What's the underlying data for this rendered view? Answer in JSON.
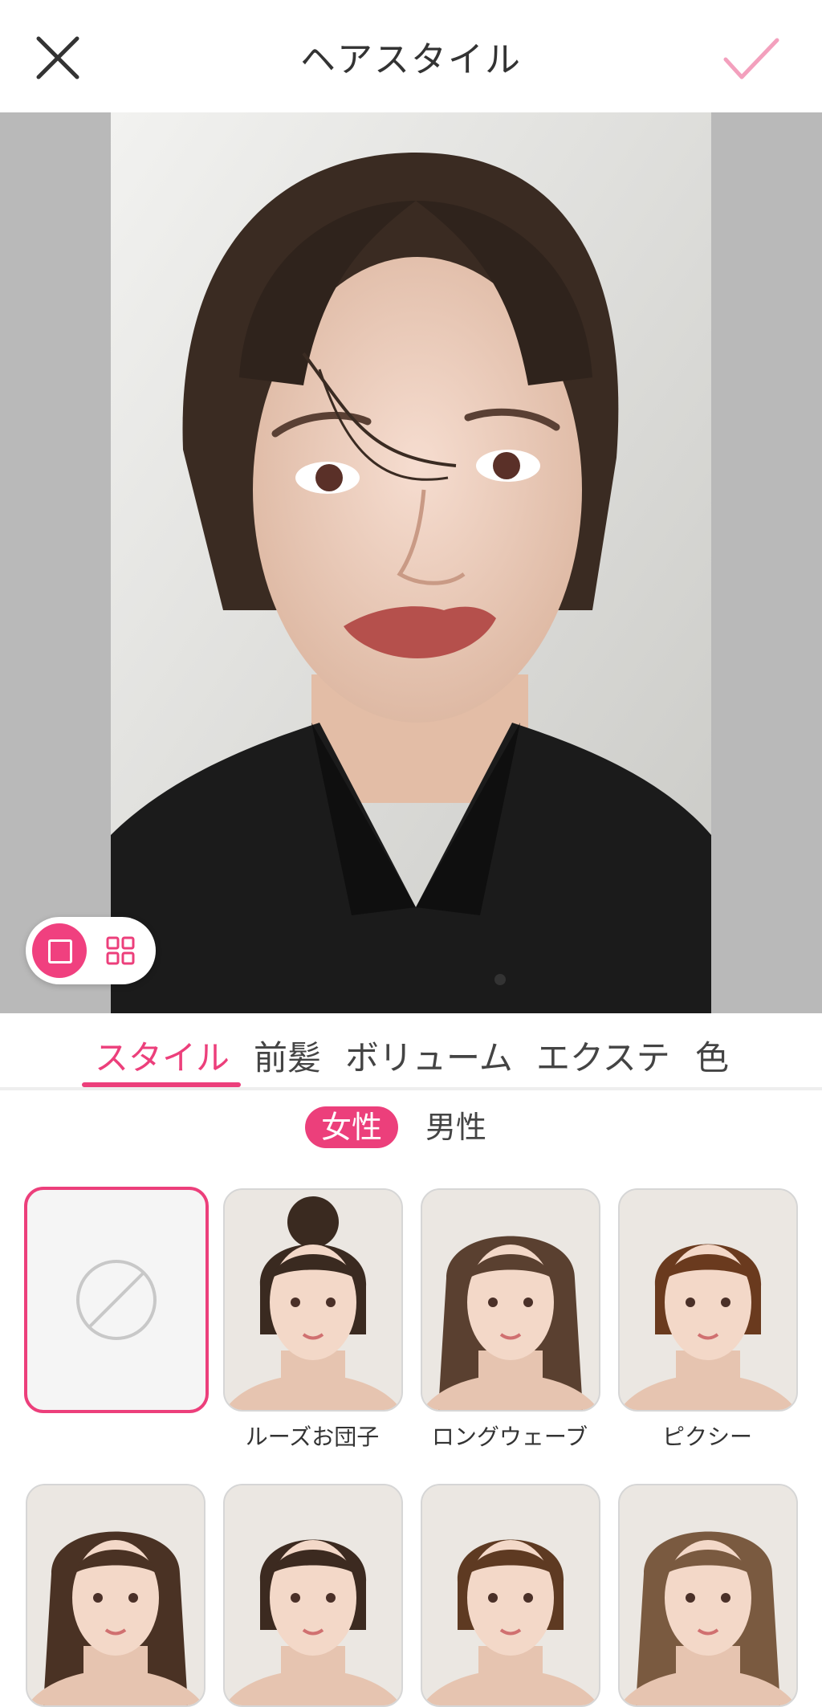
{
  "header": {
    "title": "ヘアスタイル"
  },
  "tabs": [
    {
      "label": "スタイル",
      "active": true
    },
    {
      "label": "前髪",
      "active": false
    },
    {
      "label": "ボリューム",
      "active": false
    },
    {
      "label": "エクステ",
      "active": false
    },
    {
      "label": "色",
      "active": false
    }
  ],
  "gender": {
    "female": "女性",
    "male": "男性",
    "selected": "女性"
  },
  "styles": [
    {
      "label": "",
      "type": "none",
      "selected": true
    },
    {
      "label": "ルーズお団子",
      "hair": "#3a2a20"
    },
    {
      "label": "ロングウェーブ",
      "hair": "#5a4030"
    },
    {
      "label": "ピクシー",
      "hair": "#6a3a1e"
    },
    {
      "label": "",
      "hair": "#4a3224"
    },
    {
      "label": "",
      "hair": "#3c2a20"
    },
    {
      "label": "",
      "hair": "#5e3a22"
    },
    {
      "label": "",
      "hair": "#7a5a40"
    }
  ],
  "colors": {
    "accent": "#ec3f7b",
    "preview_bg": "#b9b9b9"
  }
}
